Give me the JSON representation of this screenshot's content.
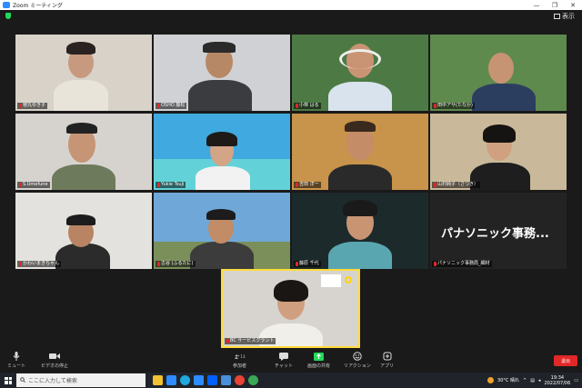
{
  "window": {
    "title": "Zoom ミーティング"
  },
  "view": {
    "label": "表示"
  },
  "tiles": [
    {
      "name": "徳丸ゆき子"
    },
    {
      "name": "OSHO 藤松"
    },
    {
      "name": "小林 はる"
    },
    {
      "name": "田中アサ(たなか)"
    },
    {
      "name": "S.Umefune"
    },
    {
      "name": "Yukie Tsuji"
    },
    {
      "name": "吉田 洋一"
    },
    {
      "name": "山村純子（さつき）"
    },
    {
      "name": "かわいまきちゃん"
    },
    {
      "name": "古谷 (ふるたに)"
    },
    {
      "name": "藤原 千代"
    },
    {
      "name": "パナソニック事務局_細材"
    },
    {
      "name": "BC サービスグラント"
    }
  ],
  "big_label": "パナソニック事務...",
  "toolbar": {
    "mute": "ミュート",
    "video": "ビデオの停止",
    "participants": "参加者",
    "participants_count": "13",
    "chat": "チャット",
    "share": "画面の共有",
    "reaction": "リアクション",
    "apps": "アプリ",
    "leave": "退出"
  },
  "taskbar": {
    "search_placeholder": "ここに入力して検索",
    "weather": "30°C 晴れ",
    "time": "19:34",
    "date": "2022/07/06"
  },
  "colors": {
    "accent": "#2d8cff",
    "leave": "#e02828",
    "share": "#23d959",
    "active_speaker": "#ffdb3a"
  }
}
